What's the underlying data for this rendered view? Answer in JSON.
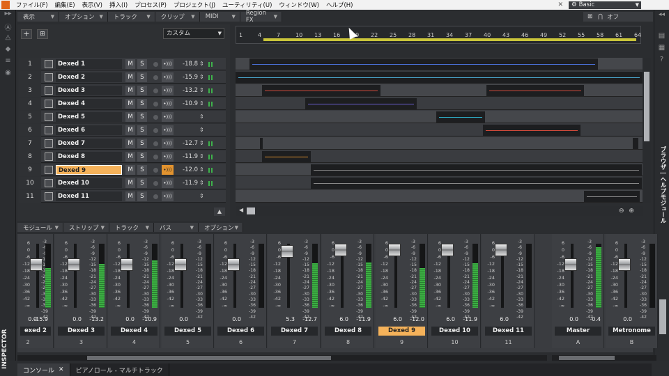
{
  "menubar": {
    "items": [
      "ファイル(F)",
      "編集(E)",
      "表示(V)",
      "挿入(I)",
      "プロセス(P)",
      "プロジェクト(J)",
      "ユーティリティ(U)",
      "ウィンドウ(W)",
      "ヘルプ(H)"
    ],
    "workspace": "Basic"
  },
  "track_menus": [
    "表示",
    "オプション",
    "トラック",
    "クリップ",
    "MIDI",
    "Region FX"
  ],
  "top_right": {
    "off_label": "オフ"
  },
  "track_view": {
    "preset": "カスタム"
  },
  "tracks": [
    {
      "num": "1",
      "name": "Dexed 1",
      "vol": "-18.8",
      "mute": "M",
      "solo": "S"
    },
    {
      "num": "2",
      "name": "Dexed 2",
      "vol": "-15.9",
      "mute": "M",
      "solo": "S"
    },
    {
      "num": "3",
      "name": "Dexed 3",
      "vol": "-13.2",
      "mute": "M",
      "solo": "S"
    },
    {
      "num": "4",
      "name": "Dexed 4",
      "vol": "-10.9",
      "mute": "M",
      "solo": "S"
    },
    {
      "num": "5",
      "name": "Dexed 5",
      "vol": "",
      "mute": "M",
      "solo": "S"
    },
    {
      "num": "6",
      "name": "Dexed 6",
      "vol": "",
      "mute": "M",
      "solo": "S"
    },
    {
      "num": "7",
      "name": "Dexed 7",
      "vol": "-12.7",
      "mute": "M",
      "solo": "S"
    },
    {
      "num": "8",
      "name": "Dexed 8",
      "vol": "-11.9",
      "mute": "M",
      "solo": "S"
    },
    {
      "num": "9",
      "name": "Dexed 9",
      "vol": "-12.0",
      "mute": "M",
      "solo": "S"
    },
    {
      "num": "10",
      "name": "Dexed 10",
      "vol": "-11.9",
      "mute": "M",
      "solo": "S"
    },
    {
      "num": "11",
      "name": "Dexed 11",
      "vol": "",
      "mute": "M",
      "solo": "S"
    }
  ],
  "ruler": {
    "ticks": [
      "1",
      "4",
      "7",
      "10",
      "13",
      "16",
      "19",
      "22",
      "25",
      "28",
      "31",
      "34",
      "37",
      "40",
      "43",
      "46",
      "49",
      "52",
      "55",
      "58",
      "61",
      "64"
    ]
  },
  "console_menus": [
    "モジュール",
    "ストリップ",
    "トラック",
    "バス",
    "オプション"
  ],
  "fader_scale": [
    "6",
    "0",
    "-6",
    "-12",
    "-18",
    "-24",
    "-30",
    "-36",
    "-42",
    "-∞"
  ],
  "meter_scale": [
    "-3",
    "-6",
    "-9",
    "-12",
    "-15",
    "-18",
    "-21",
    "-24",
    "-27",
    "-30",
    "-33",
    "-36",
    "-39",
    "-42"
  ],
  "strips": [
    {
      "name": "exed 2",
      "num": "2",
      "vL": "0.0",
      "vR": "-15.9",
      "fader": 0.72,
      "meter": 0.62
    },
    {
      "name": "Dexed 3",
      "num": "3",
      "vL": "0.0",
      "vR": "-13.2",
      "fader": 0.72,
      "meter": 0.68
    },
    {
      "name": "Dexed 4",
      "num": "4",
      "vL": "0.0",
      "vR": "-10.9",
      "fader": 0.72,
      "meter": 0.74
    },
    {
      "name": "Dexed 5",
      "num": "5",
      "vL": "0.0",
      "vR": "",
      "fader": 0.72,
      "meter": 0.0
    },
    {
      "name": "Dexed 6",
      "num": "6",
      "vL": "0.0",
      "vR": "",
      "fader": 0.72,
      "meter": 0.0
    },
    {
      "name": "Dexed 7",
      "num": "7",
      "vL": "5.3",
      "vR": "-12.7",
      "fader": 0.97,
      "meter": 0.7
    },
    {
      "name": "Dexed 8",
      "num": "8",
      "vL": "6.0",
      "vR": "-11.9",
      "fader": 1.0,
      "meter": 0.71
    },
    {
      "name": "Dexed 9",
      "num": "9",
      "vL": "6.0",
      "vR": "-12.0",
      "fader": 1.0,
      "meter": 0.62
    },
    {
      "name": "Dexed 10",
      "num": "10",
      "vL": "6.0",
      "vR": "-11.9",
      "fader": 1.0,
      "meter": 0.7
    },
    {
      "name": "Dexed 11",
      "num": "11",
      "vL": "6.0",
      "vR": "",
      "fader": 1.0,
      "meter": 0.0
    },
    {
      "name": "Master",
      "num": "A",
      "vL": "0.0",
      "vR": "-0.4",
      "fader": 0.72,
      "meter": 0.95
    },
    {
      "name": "Metronome",
      "num": "B",
      "vL": "0.0",
      "vR": "",
      "fader": 0.72,
      "meter": 0.0
    }
  ],
  "right_rail": {
    "browser_label": "ブラウザ | ヘルプモジュール"
  },
  "left_rail": {
    "inspector_label": "INSPECTOR"
  },
  "bottom_tabs": [
    "コンソール",
    "ピアノロール - マルチトラック"
  ],
  "colors": {
    "accent": "#f5b25a",
    "meter": "#3cb043",
    "loop": "#c9c43a"
  }
}
